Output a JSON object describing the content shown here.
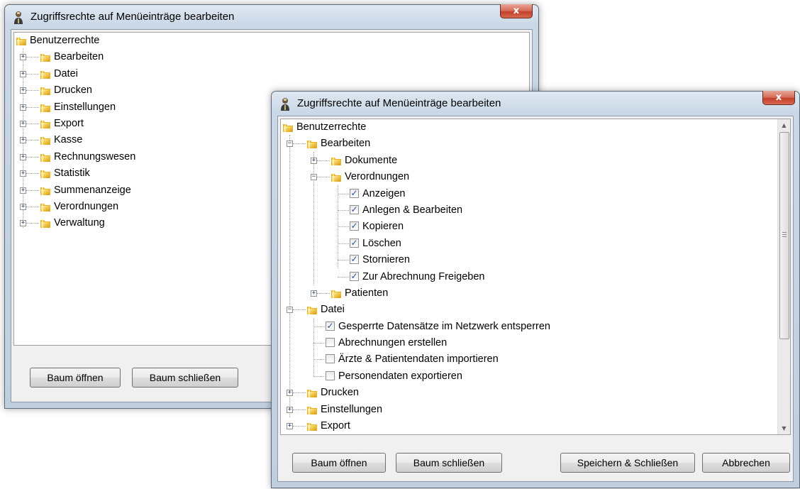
{
  "back_window": {
    "title": "Zugriffsrechte auf Menüeinträge bearbeiten",
    "close_label": "x",
    "root": "Benutzerrechte",
    "items": [
      "Bearbeiten",
      "Datei",
      "Drucken",
      "Einstellungen",
      "Export",
      "Kasse",
      "Rechnungswesen",
      "Statistik",
      "Summenanzeige",
      "Verordnungen",
      "Verwaltung"
    ],
    "buttons": {
      "open": "Baum öffnen",
      "close_tree": "Baum schließen"
    }
  },
  "front_window": {
    "title": "Zugriffsrechte auf Menüeinträge bearbeiten",
    "close_label": "x",
    "root": "Benutzerrechte",
    "bearbeiten": {
      "label": "Bearbeiten",
      "dokumente": "Dokumente",
      "verordnungen": {
        "label": "Verordnungen",
        "rights": [
          {
            "label": "Anzeigen",
            "checked": true
          },
          {
            "label": "Anlegen & Bearbeiten",
            "checked": true
          },
          {
            "label": "Kopieren",
            "checked": true
          },
          {
            "label": "Löschen",
            "checked": true
          },
          {
            "label": "Stornieren",
            "checked": true
          },
          {
            "label": "Zur Abrechnung Freigeben",
            "checked": true
          }
        ]
      },
      "patienten": "Patienten"
    },
    "datei": {
      "label": "Datei",
      "rights": [
        {
          "label": "Gesperrte Datensätze im Netzwerk entsperren",
          "checked": true
        },
        {
          "label": "Abrechnungen erstellen",
          "checked": false
        },
        {
          "label": "Ärzte & Patientendaten importieren",
          "checked": false
        },
        {
          "label": "Personendaten exportieren",
          "checked": false
        }
      ]
    },
    "more_items": [
      "Drucken",
      "Einstellungen",
      "Export"
    ],
    "buttons": {
      "open": "Baum öffnen",
      "close_tree": "Baum schließen",
      "save": "Speichern & Schließen",
      "cancel": "Abbrechen"
    }
  }
}
